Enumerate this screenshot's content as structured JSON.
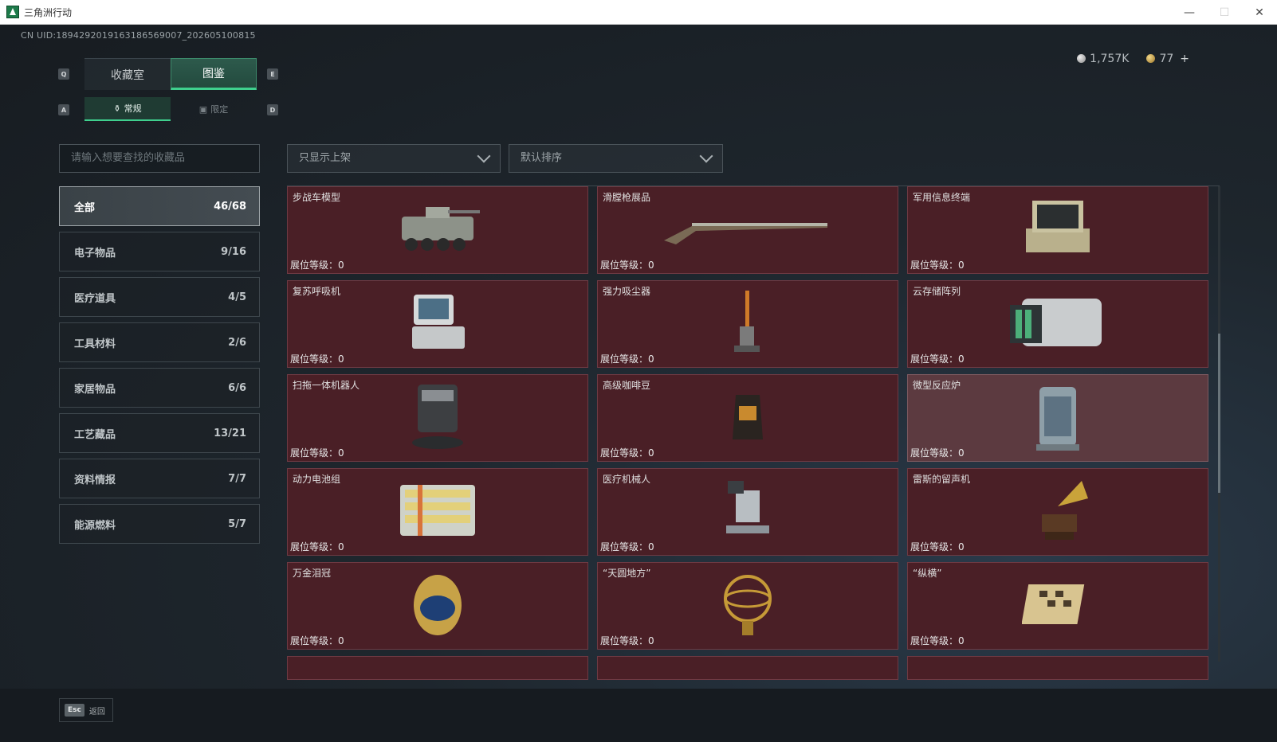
{
  "window": {
    "title": "三角洲行动",
    "minimize": "—",
    "maximize": "☐",
    "close": "✕"
  },
  "uid": "CN UID:1894292019163186569007_202605100815",
  "currency": {
    "silver": "1,757K",
    "gold": "77",
    "plus": "+"
  },
  "keys": {
    "prev_tab": "Q",
    "next_tab": "E",
    "prev_sub": "A",
    "next_sub": "D",
    "esc": "Esc"
  },
  "tabs": [
    {
      "label": "收藏室"
    },
    {
      "label": "图鉴"
    }
  ],
  "sub_tabs": [
    {
      "label": "常规"
    },
    {
      "label": "限定"
    }
  ],
  "search": {
    "placeholder": "请输入想要查找的收藏品"
  },
  "filter": {
    "value": "只显示上架"
  },
  "sort": {
    "value": "默认排序"
  },
  "categories": [
    {
      "label": "全部",
      "count": "46/68"
    },
    {
      "label": "电子物品",
      "count": "9/16"
    },
    {
      "label": "医疗道具",
      "count": "4/5"
    },
    {
      "label": "工具材料",
      "count": "2/6"
    },
    {
      "label": "家居物品",
      "count": "6/6"
    },
    {
      "label": "工艺藏品",
      "count": "13/21"
    },
    {
      "label": "资料情报",
      "count": "7/7"
    },
    {
      "label": "能源燃料",
      "count": "5/7"
    }
  ],
  "level_label": "展位等级：0",
  "items": [
    {
      "name": "步战车模型",
      "icon": "ifv-model-icon"
    },
    {
      "name": "滑膛枪展品",
      "icon": "musket-icon"
    },
    {
      "name": "军用信息终端",
      "icon": "military-terminal-icon"
    },
    {
      "name": "复苏呼吸机",
      "icon": "ventilator-icon"
    },
    {
      "name": "强力吸尘器",
      "icon": "vacuum-cleaner-icon"
    },
    {
      "name": "云存储阵列",
      "icon": "storage-array-icon"
    },
    {
      "name": "扫拖一体机器人",
      "icon": "robot-mop-icon"
    },
    {
      "name": "高级咖啡豆",
      "icon": "coffee-bag-icon"
    },
    {
      "name": "微型反应炉",
      "icon": "micro-reactor-icon"
    },
    {
      "name": "动力电池组",
      "icon": "battery-pack-icon"
    },
    {
      "name": "医疗机械人",
      "icon": "medical-robot-icon"
    },
    {
      "name": "雷斯的留声机",
      "icon": "gramophone-icon"
    },
    {
      "name": "万金泪冠",
      "icon": "jeweled-egg-icon"
    },
    {
      "name": "“天圆地方”",
      "icon": "armillary-sphere-icon"
    },
    {
      "name": "“纵横”",
      "icon": "chess-board-icon"
    }
  ],
  "footer": {
    "back": "返回"
  }
}
